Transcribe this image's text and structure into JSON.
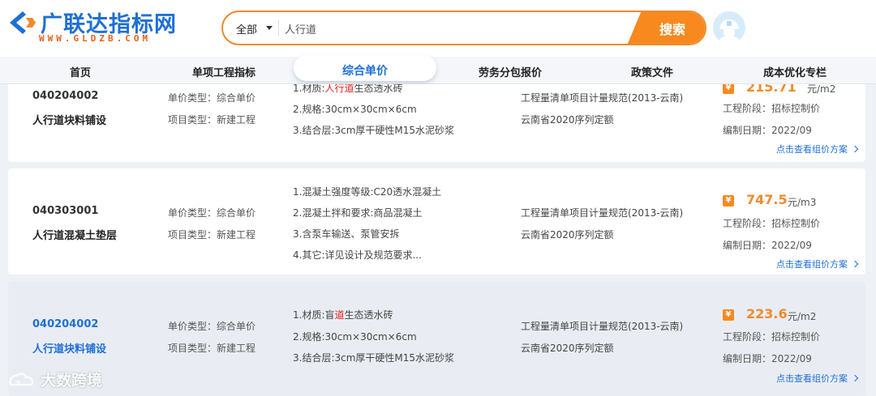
{
  "logo": {
    "title": "广联达指标网",
    "subtitle": "WWW.GLDZB.COM"
  },
  "search": {
    "category": "全部",
    "query": "人行道",
    "button": "搜索"
  },
  "nav": {
    "items": [
      "首页",
      "单项工程指标",
      "综合单价",
      "劳务分包报价",
      "政策文件",
      "成本优化专栏"
    ],
    "active": "综合单价"
  },
  "cards": [
    {
      "code": "040204002",
      "name": "人行道块料铺设",
      "price_type": "单价类型：综合单价",
      "project_type": "项目类型：新建工程",
      "specs": [
        {
          "pre": "1.材质:",
          "hl": "人行道",
          "post": "生态透水砖"
        },
        {
          "pre": "2.规格:30cm×30cm×6cm",
          "hl": "",
          "post": ""
        },
        {
          "pre": "3.结合层:3cm厚干硬性M15水泥砂浆",
          "hl": "",
          "post": ""
        }
      ],
      "standard": "工程量清单项目计量规范(2013-云南)",
      "quota": "云南省2020序列定额",
      "price": "215.71",
      "unit": "元/m2",
      "stage": "工程阶段：招标控制价",
      "date": "编制日期：2022/09",
      "link": "点击查看组价方案"
    },
    {
      "code": "040303001",
      "name": "人行道混凝土垫层",
      "price_type": "单价类型：综合单价",
      "project_type": "项目类型：新建工程",
      "specs": [
        {
          "pre": "1.混凝土强度等级:C20透水混凝土",
          "hl": "",
          "post": ""
        },
        {
          "pre": "2.混凝土拌和要求:商品混凝土",
          "hl": "",
          "post": ""
        },
        {
          "pre": "3.含泵车输送、泵管安拆",
          "hl": "",
          "post": ""
        },
        {
          "pre": "4.其它:详见设计及规范要求...",
          "hl": "",
          "post": ""
        }
      ],
      "standard": "工程量清单项目计量规范(2013-云南)",
      "quota": "云南省2020序列定额",
      "price": "747.5",
      "unit": "元/m3",
      "stage": "工程阶段：招标控制价",
      "date": "编制日期：2022/09",
      "link": "点击查看组价方案"
    },
    {
      "code": "040204002",
      "name": "人行道块料铺设",
      "price_type": "单价类型：综合单价",
      "project_type": "项目类型：新建工程",
      "specs": [
        {
          "pre": "1.材质:盲",
          "hl": "道",
          "post": "生态透水砖"
        },
        {
          "pre": "2.规格:30cm×30cm×6cm",
          "hl": "",
          "post": ""
        },
        {
          "pre": "3.结合层:3cm厚干硬性M15水泥砂浆",
          "hl": "",
          "post": ""
        }
      ],
      "standard": "工程量清单项目计量规范(2013-云南)",
      "quota": "云南省2020序列定额",
      "price": "223.6",
      "unit": "元/m2",
      "stage": "工程阶段：招标控制价",
      "date": "编制日期：2022/09",
      "link": "点击查看组价方案"
    }
  ],
  "watermark": "大数跨境",
  "colors": {
    "brand_blue": "#1f6fd6",
    "accent_orange": "#f7891f",
    "highlight_red": "#e02020"
  }
}
